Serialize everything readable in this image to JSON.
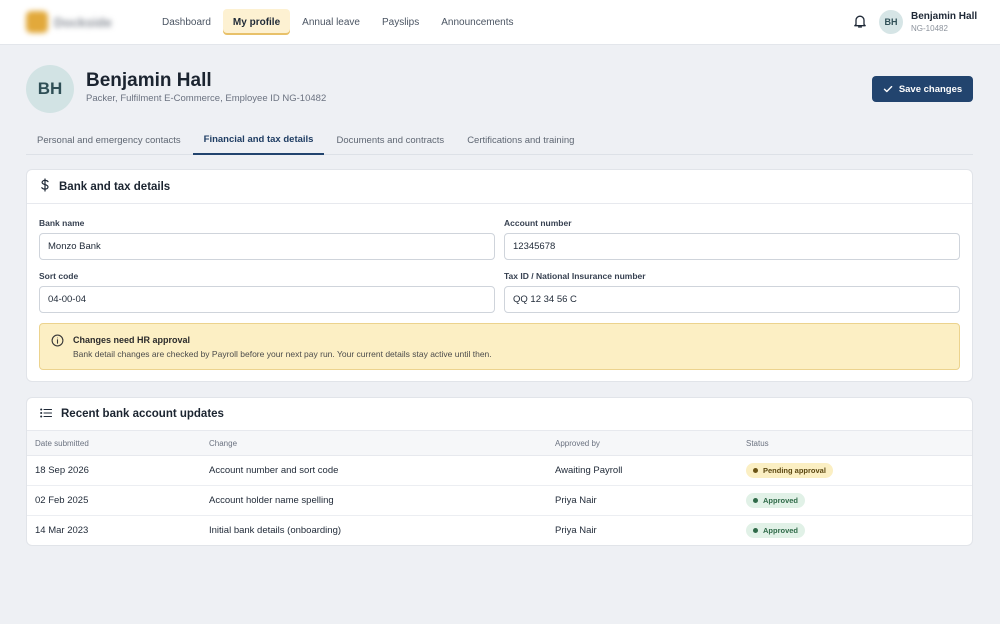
{
  "brand": {
    "name": "Dockside",
    "accent": "#22446e",
    "highlight": "#fdf1d2"
  },
  "nav": {
    "items": [
      "Dashboard",
      "My profile",
      "Annual leave",
      "Payslips",
      "Announcements"
    ],
    "active": "My profile"
  },
  "user": {
    "initials": "BH",
    "name": "Benjamin Hall",
    "id": "NG-10482"
  },
  "profile": {
    "initials": "BH",
    "name": "Benjamin Hall",
    "subtitle": "Packer, Fulfilment E-Commerce, Employee ID NG-10482",
    "save_label": "Save changes"
  },
  "tabs": [
    {
      "label": "Personal and emergency contacts"
    },
    {
      "label": "Financial and tax details"
    },
    {
      "label": "Documents and contracts"
    },
    {
      "label": "Certifications and training"
    }
  ],
  "active_tab": "Financial and tax details",
  "bank": {
    "title": "Bank and tax details",
    "icon": "dollar-icon",
    "bank_name_label": "Bank name",
    "bank_name": "Monzo Bank",
    "account_number_label": "Account number",
    "account_number": "12345678",
    "sort_code_label": "Sort code",
    "sort_code": "04-00-04",
    "tax_id_label": "Tax ID / National Insurance number",
    "tax_id": "QQ 12 34 56 C",
    "notice_title": "Changes need HR approval",
    "notice_text": "Bank detail changes are checked by Payroll before your next pay run. Your current details stay active until then."
  },
  "updates": {
    "title": "Recent bank account updates",
    "icon": "list-icon",
    "columns": [
      "Date submitted",
      "Change",
      "Approved by",
      "Status"
    ],
    "rows": [
      {
        "date": "18 Sep 2026",
        "change": "Account number and sort code",
        "approved_by": "Awaiting Payroll",
        "status": "Pending approval",
        "status_kind": "pending"
      },
      {
        "date": "02 Feb 2025",
        "change": "Account holder name spelling",
        "approved_by": "Priya Nair",
        "status": "Approved",
        "status_kind": "approved"
      },
      {
        "date": "14 Mar 2023",
        "change": "Initial bank details (onboarding)",
        "approved_by": "Priya Nair",
        "status": "Approved",
        "status_kind": "approved"
      }
    ]
  }
}
